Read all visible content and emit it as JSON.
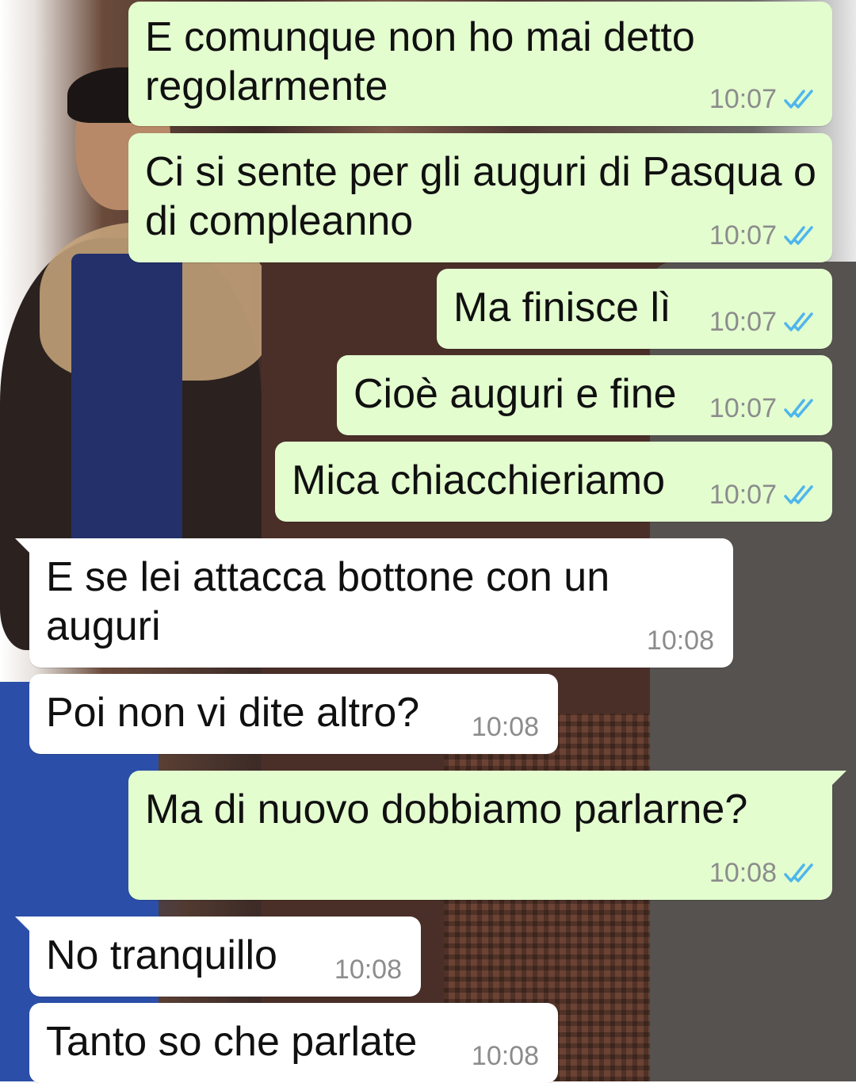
{
  "colors": {
    "outgoing_bubble": "#e3fdcf",
    "incoming_bubble": "#ffffff",
    "timestamp": "#8c8c8c",
    "read_ticks": "#4fb6ec"
  },
  "messages": [
    {
      "direction": "outgoing",
      "text": "E comunque non ho mai detto\nregolarmente",
      "time": "10:07",
      "status_icon": "double-check-read-icon"
    },
    {
      "direction": "outgoing",
      "text": "Ci si sente per gli auguri di Pasqua o\ndi compleanno",
      "time": "10:07",
      "status_icon": "double-check-read-icon"
    },
    {
      "direction": "outgoing",
      "text": "Ma finisce lì",
      "time": "10:07",
      "status_icon": "double-check-read-icon"
    },
    {
      "direction": "outgoing",
      "text": "Cioè auguri e fine",
      "time": "10:07",
      "status_icon": "double-check-read-icon"
    },
    {
      "direction": "outgoing",
      "text": "Mica chiacchieriamo",
      "time": "10:07",
      "status_icon": "double-check-read-icon"
    },
    {
      "direction": "incoming",
      "text": "E se lei attacca bottone con un\nauguri",
      "time": "10:08"
    },
    {
      "direction": "incoming",
      "text": "Poi non vi dite altro?",
      "time": "10:08"
    },
    {
      "direction": "outgoing",
      "text": "Ma di nuovo dobbiamo parlarne?",
      "time": "10:08",
      "status_icon": "double-check-read-icon"
    },
    {
      "direction": "incoming",
      "text": "No tranquillo",
      "time": "10:08"
    },
    {
      "direction": "incoming",
      "text": "Tanto so che parlate",
      "time": "10:08"
    }
  ]
}
